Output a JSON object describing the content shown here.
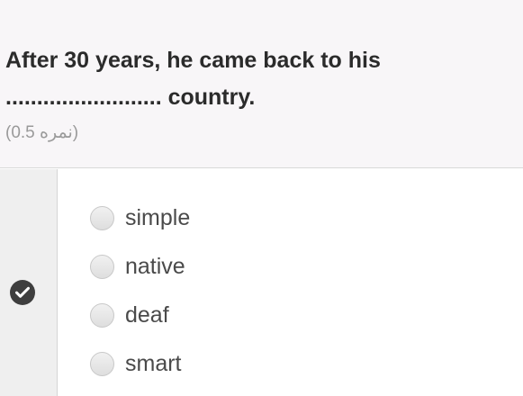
{
  "question": {
    "line1": "After 30 years, he came back to his",
    "line2": "......................... country.",
    "score": "(نمره 0.5)"
  },
  "status": {
    "icon": "check-circle-icon"
  },
  "options": [
    {
      "label": "simple"
    },
    {
      "label": "native"
    },
    {
      "label": "deaf"
    },
    {
      "label": "smart"
    }
  ]
}
